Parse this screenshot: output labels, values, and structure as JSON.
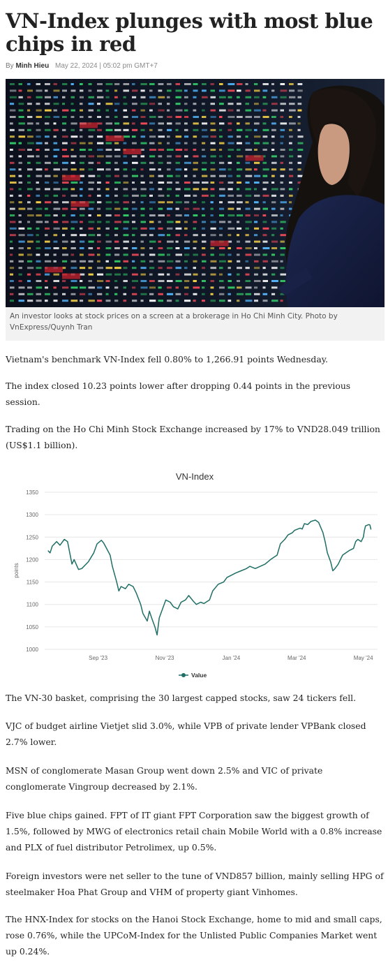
{
  "article": {
    "title": "VN-Index plunges with most blue chips in red",
    "byline": {
      "by": "By",
      "author": "Minh Hieu",
      "date": "May 22, 2024 | 05:02 pm GMT+7"
    },
    "photo": {
      "caption": "An investor looks at stock prices on a screen at a brokerage in Ho Chi Minh City. Photo by VnExpress/Quynh Tran"
    },
    "paragraphs": [
      "Vietnam's benchmark VN-Index fell 0.80% to 1,266.91 points Wednesday.",
      "The index closed 10.23 points lower after dropping 0.44 points in the previous session.",
      "Trading on the Ho Chi Minh Stock Exchange increased by 17% to VND28.049 trillion (US$1.1 billion).",
      "The VN-30 basket, comprising the 30 largest capped stocks, saw 24 tickers fell.",
      "VJC of budget airline Vietjet slid 3.0%, while VPB of private lender VPBank closed 2.7% lower.",
      "MSN of conglomerate Masan Group went down 2.5% and VIC of private conglomerate Vingroup decreased by 2.1%.",
      "Five blue chips gained. FPT of IT giant FPT Corporation saw the biggest growth of 1.5%, followed by MWG of electronics retail chain Mobile World with a 0.8% increase and PLX of fuel distributor Petrolimex, up 0.5%.",
      "Foreign investors were net seller to the tune of VND857 billion, mainly selling HPG of steelmaker Hoa Phat Group and VHM of property giant Vinhomes.",
      "The HNX-Index for stocks on the Hanoi Stock Exchange, home to mid and small caps, rose 0.76%, while the UPCoM-Index for the Unlisted Public Companies Market went up 0.24%."
    ]
  },
  "colors": {
    "line": "#1f6f66",
    "grid": "#e6e6e6",
    "axis_text": "#666666"
  },
  "chart_data": {
    "type": "line",
    "title": "VN-Index",
    "ylabel": "points",
    "xlabel": "",
    "ylim": [
      1000,
      1350
    ],
    "yticks": [
      1000,
      1050,
      1100,
      1150,
      1200,
      1250,
      1300,
      1350
    ],
    "xlim": [
      "2023-07-28",
      "2024-05-28"
    ],
    "xticks": [
      {
        "date": "2023-09-15",
        "label": "Sep '23"
      },
      {
        "date": "2023-11-15",
        "label": "Nov '23"
      },
      {
        "date": "2024-01-15",
        "label": "Jan '24"
      },
      {
        "date": "2024-03-15",
        "label": "Mar '24"
      },
      {
        "date": "2024-05-15",
        "label": "May '24"
      }
    ],
    "grid": true,
    "legend": "bottom",
    "series": [
      {
        "name": "Value",
        "points": [
          [
            "2023-07-31",
            1220
          ],
          [
            "2023-08-02",
            1215
          ],
          [
            "2023-08-04",
            1230
          ],
          [
            "2023-08-08",
            1240
          ],
          [
            "2023-08-11",
            1232
          ],
          [
            "2023-08-15",
            1245
          ],
          [
            "2023-08-18",
            1240
          ],
          [
            "2023-08-22",
            1190
          ],
          [
            "2023-08-24",
            1200
          ],
          [
            "2023-08-28",
            1178
          ],
          [
            "2023-08-31",
            1180
          ],
          [
            "2023-09-06",
            1195
          ],
          [
            "2023-09-11",
            1215
          ],
          [
            "2023-09-14",
            1235
          ],
          [
            "2023-09-18",
            1243
          ],
          [
            "2023-09-20",
            1237
          ],
          [
            "2023-09-22",
            1228
          ],
          [
            "2023-09-26",
            1210
          ],
          [
            "2023-09-28",
            1185
          ],
          [
            "2023-10-02",
            1150
          ],
          [
            "2023-10-04",
            1130
          ],
          [
            "2023-10-06",
            1140
          ],
          [
            "2023-10-10",
            1135
          ],
          [
            "2023-10-13",
            1145
          ],
          [
            "2023-10-17",
            1140
          ],
          [
            "2023-10-20",
            1125
          ],
          [
            "2023-10-24",
            1100
          ],
          [
            "2023-10-26",
            1080
          ],
          [
            "2023-10-30",
            1063
          ],
          [
            "2023-11-01",
            1085
          ],
          [
            "2023-11-03",
            1070
          ],
          [
            "2023-11-06",
            1050
          ],
          [
            "2023-11-08",
            1032
          ],
          [
            "2023-11-10",
            1070
          ],
          [
            "2023-11-13",
            1090
          ],
          [
            "2023-11-16",
            1110
          ],
          [
            "2023-11-20",
            1105
          ],
          [
            "2023-11-23",
            1095
          ],
          [
            "2023-11-27",
            1090
          ],
          [
            "2023-11-30",
            1105
          ],
          [
            "2023-12-04",
            1110
          ],
          [
            "2023-12-07",
            1120
          ],
          [
            "2023-12-11",
            1108
          ],
          [
            "2023-12-14",
            1100
          ],
          [
            "2023-12-18",
            1105
          ],
          [
            "2023-12-21",
            1102
          ],
          [
            "2023-12-26",
            1110
          ],
          [
            "2023-12-29",
            1130
          ],
          [
            "2024-01-03",
            1145
          ],
          [
            "2024-01-08",
            1150
          ],
          [
            "2024-01-11",
            1160
          ],
          [
            "2024-01-15",
            1165
          ],
          [
            "2024-01-19",
            1170
          ],
          [
            "2024-01-24",
            1175
          ],
          [
            "2024-01-29",
            1180
          ],
          [
            "2024-02-01",
            1185
          ],
          [
            "2024-02-06",
            1180
          ],
          [
            "2024-02-15",
            1190
          ],
          [
            "2024-02-20",
            1200
          ],
          [
            "2024-02-26",
            1210
          ],
          [
            "2024-02-29",
            1235
          ],
          [
            "2024-03-04",
            1245
          ],
          [
            "2024-03-07",
            1255
          ],
          [
            "2024-03-11",
            1260
          ],
          [
            "2024-03-13",
            1265
          ],
          [
            "2024-03-18",
            1270
          ],
          [
            "2024-03-20",
            1268
          ],
          [
            "2024-03-22",
            1280
          ],
          [
            "2024-03-25",
            1278
          ],
          [
            "2024-03-28",
            1285
          ],
          [
            "2024-04-01",
            1288
          ],
          [
            "2024-04-04",
            1283
          ],
          [
            "2024-04-08",
            1260
          ],
          [
            "2024-04-10",
            1240
          ],
          [
            "2024-04-12",
            1215
          ],
          [
            "2024-04-15",
            1195
          ],
          [
            "2024-04-17",
            1175
          ],
          [
            "2024-04-19",
            1180
          ],
          [
            "2024-04-22",
            1190
          ],
          [
            "2024-04-24",
            1200
          ],
          [
            "2024-04-26",
            1210
          ],
          [
            "2024-05-02",
            1220
          ],
          [
            "2024-05-06",
            1225
          ],
          [
            "2024-05-08",
            1240
          ],
          [
            "2024-05-10",
            1245
          ],
          [
            "2024-05-13",
            1240
          ],
          [
            "2024-05-15",
            1250
          ],
          [
            "2024-05-16",
            1265
          ],
          [
            "2024-05-17",
            1275
          ],
          [
            "2024-05-20",
            1278
          ],
          [
            "2024-05-21",
            1277
          ],
          [
            "2024-05-22",
            1267
          ]
        ]
      }
    ]
  }
}
